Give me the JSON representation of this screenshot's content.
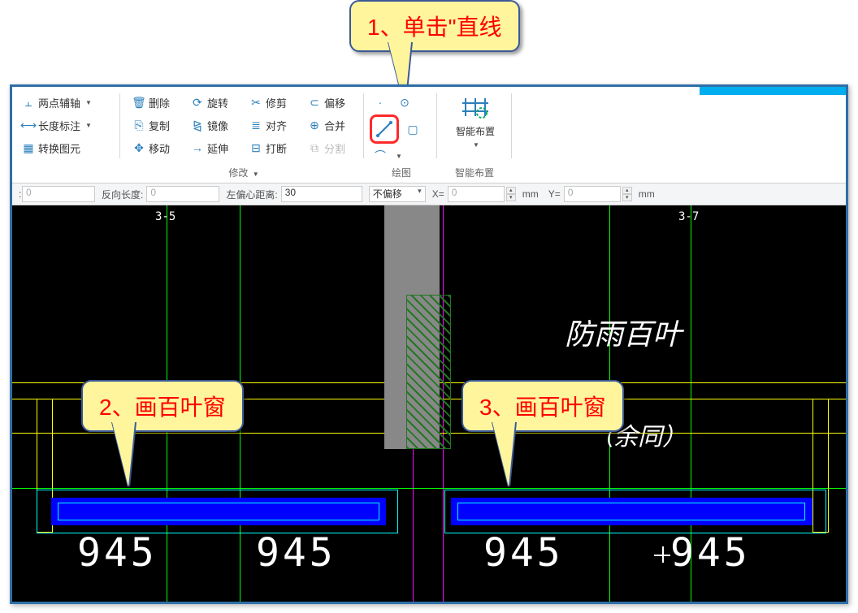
{
  "callouts": {
    "c1": "1、单击\"直线",
    "c2": "2、画百叶窗",
    "c3": "3、画百叶窗"
  },
  "ribbon": {
    "col1": {
      "two_point_axis": "两点辅轴",
      "length_dim": "长度标注",
      "convert_elem": "转换图元"
    },
    "col2": {
      "delete": "删除",
      "copy": "复制",
      "move": "移动"
    },
    "col3": {
      "rotate": "旋转",
      "mirror": "镜像",
      "extend": "延伸"
    },
    "col4": {
      "trim": "修剪",
      "align": "对齐",
      "break": "打断"
    },
    "col5": {
      "offset": "偏移",
      "merge": "合并",
      "split": "分割"
    },
    "group_modify": "修改",
    "group_draw": "绘图",
    "smart_layout_btn": "智能布置",
    "group_smart": "智能布置"
  },
  "params": {
    "len_val": "0",
    "rev_len_label": "反向长度:",
    "rev_len_val": "0",
    "left_offset_label": "左偏心距离:",
    "left_offset_val": "30",
    "offset_mode": "不偏移",
    "x_label": "X=",
    "x_val": "0",
    "xy_unit": "mm",
    "y_label": "Y=",
    "y_val": "0"
  },
  "canvas": {
    "label_3_5": "3-5",
    "label_3_7": "3-7",
    "text_rain_louver": "防雨百叶",
    "text_yuwen": "（余同）",
    "dim_945": "945"
  }
}
